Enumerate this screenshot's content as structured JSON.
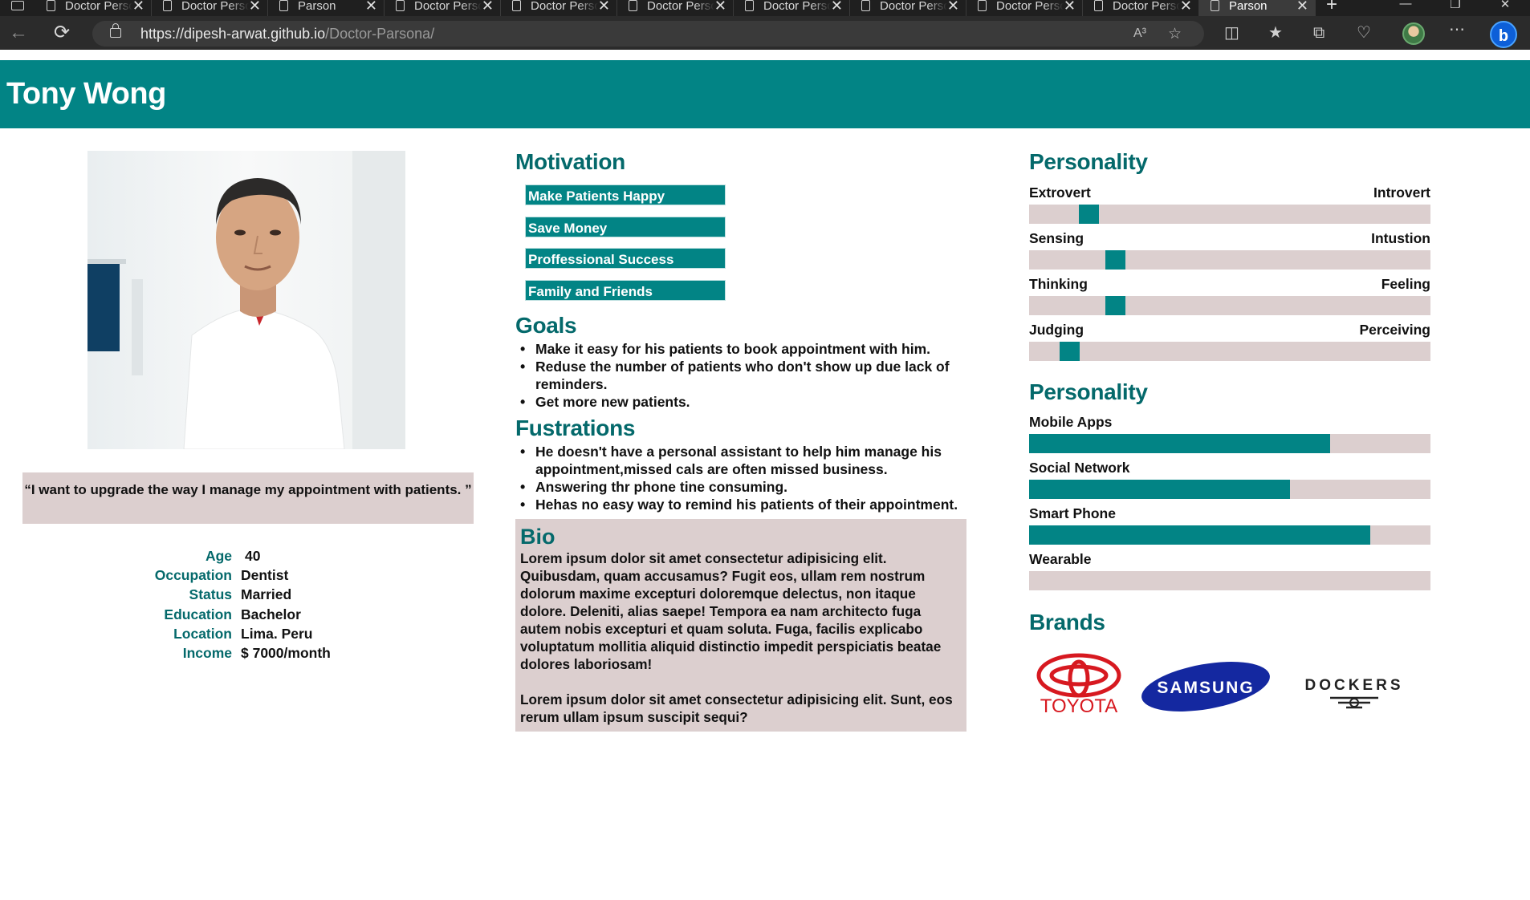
{
  "browser": {
    "tabs": [
      {
        "title": "Doctor Persona",
        "active": false
      },
      {
        "title": "Doctor Persona",
        "active": false
      },
      {
        "title": "Parson",
        "active": false
      },
      {
        "title": "Doctor Persona",
        "active": false
      },
      {
        "title": "Doctor Persona",
        "active": false
      },
      {
        "title": "Doctor Persona",
        "active": false
      },
      {
        "title": "Doctor Persona",
        "active": false
      },
      {
        "title": "Doctor Persona",
        "active": false
      },
      {
        "title": "Doctor Persona",
        "active": false
      },
      {
        "title": "Doctor Persona",
        "active": false
      },
      {
        "title": "Parson",
        "active": true
      }
    ],
    "url_host": "https://dipesh-arwat.github.io",
    "url_path": "/Doctor-Parsona/",
    "read_aloud_label": "A³"
  },
  "persona": {
    "name": "Tony Wong",
    "quote": "“I want to upgrade the way I manage my appointment with patients. ”",
    "info": [
      {
        "label": "Age",
        "value": "40"
      },
      {
        "label": "Occupation",
        "value": "Dentist"
      },
      {
        "label": "Status",
        "value": "Married"
      },
      {
        "label": "Education",
        "value": "Bachelor"
      },
      {
        "label": "Location",
        "value": "Lima. Peru"
      },
      {
        "label": "Income",
        "value": "$ 7000/month"
      }
    ]
  },
  "motivation": {
    "title": "Motivation",
    "items": [
      "Make Patients Happy",
      "Save Money",
      "Proffessional Success",
      "Family and Friends"
    ]
  },
  "goals": {
    "title": "Goals",
    "items": [
      "Make it easy for his patients to book appointment with him.",
      "Reduse the number of patients who don't show up due lack of reminders.",
      "Get more new patients."
    ]
  },
  "frustrations": {
    "title": "Fustrations",
    "items": [
      "He doesn't have a personal assistant to help him manage his appointment,missed cals are often missed business.",
      "Answering thr phone tine consuming.",
      "Hehas no easy way to remind his patients of their appointment."
    ]
  },
  "bio": {
    "title": "Bio",
    "paragraphs": [
      "Lorem ipsum dolor sit amet consectetur adipisicing elit. Quibusdam, quam accusamus? Fugit eos, ullam rem nostrum dolorum maxime excepturi doloremque delectus, non itaque dolore. Deleniti, alias saepe! Tempora ea nam architecto fuga autem nobis excepturi et quam soluta. Fuga, facilis explicabo voluptatum mollitia aliquid distinctio impedit perspiciatis beatae dolores laboriosam!",
      "Lorem ipsum dolor sit amet consectetur adipisicing elit. Sunt, eos rerum ullam ipsum suscipit sequi?"
    ]
  },
  "personality": {
    "title": "Personality",
    "scales": [
      {
        "left": "Extrovert",
        "right": "Introvert",
        "position": 0.13
      },
      {
        "left": "Sensing",
        "right": "Intustion",
        "position": 0.2
      },
      {
        "left": "Thinking",
        "right": "Feeling",
        "position": 0.2
      },
      {
        "left": "Judging",
        "right": "Perceiving",
        "position": 0.08
      }
    ]
  },
  "technology": {
    "title": "Personality",
    "items": [
      {
        "label": "Mobile Apps",
        "level": 0.75
      },
      {
        "label": "Social Network",
        "level": 0.65
      },
      {
        "label": "Smart Phone",
        "level": 0.85
      },
      {
        "label": "Wearable",
        "level": 0.0
      }
    ]
  },
  "brands": {
    "title": "Brands",
    "logos": [
      {
        "name": "toyota-logo",
        "text": "TOYOTA",
        "color": "#d71920"
      },
      {
        "name": "samsung-logo",
        "text": "SAMSUNG",
        "color": "#1428a0"
      },
      {
        "name": "dockers-logo",
        "text": "DOCKERS",
        "color": "#222222"
      }
    ]
  },
  "colors": {
    "accent": "#028485",
    "heading": "#04696b",
    "panel": "#dccfcf"
  }
}
